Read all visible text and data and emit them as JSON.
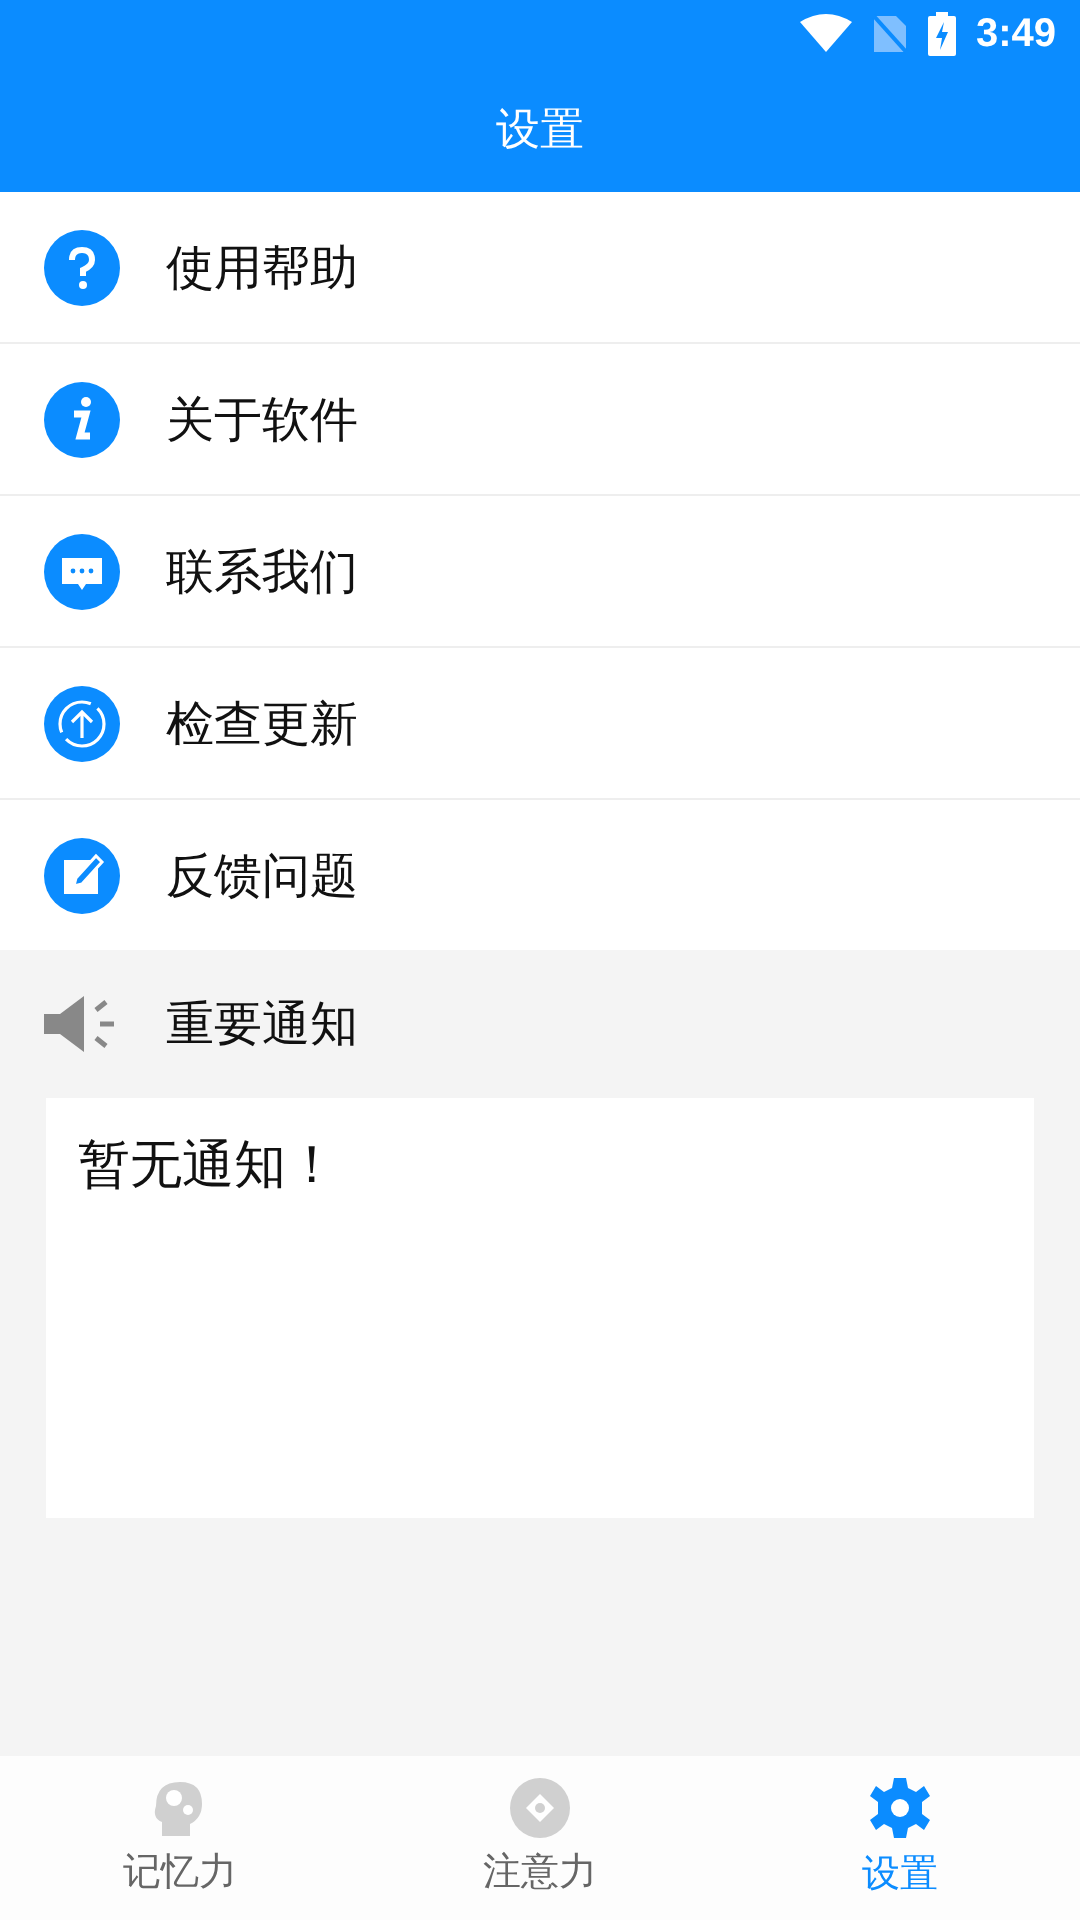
{
  "status_bar": {
    "time": "3:49"
  },
  "header": {
    "title": "设置"
  },
  "menu": [
    {
      "label": "使用帮助",
      "kind": "help"
    },
    {
      "label": "关于软件",
      "kind": "info"
    },
    {
      "label": "联系我们",
      "kind": "chat"
    },
    {
      "label": "检查更新",
      "kind": "update"
    },
    {
      "label": "反馈问题",
      "kind": "edit"
    }
  ],
  "notice": {
    "title": "重要通知",
    "text": "暂无通知！"
  },
  "tabs": [
    {
      "label": "记忆力",
      "kind": "head",
      "selected": false
    },
    {
      "label": "注意力",
      "kind": "target",
      "selected": false
    },
    {
      "label": "设置",
      "kind": "gear",
      "selected": true
    }
  ]
}
